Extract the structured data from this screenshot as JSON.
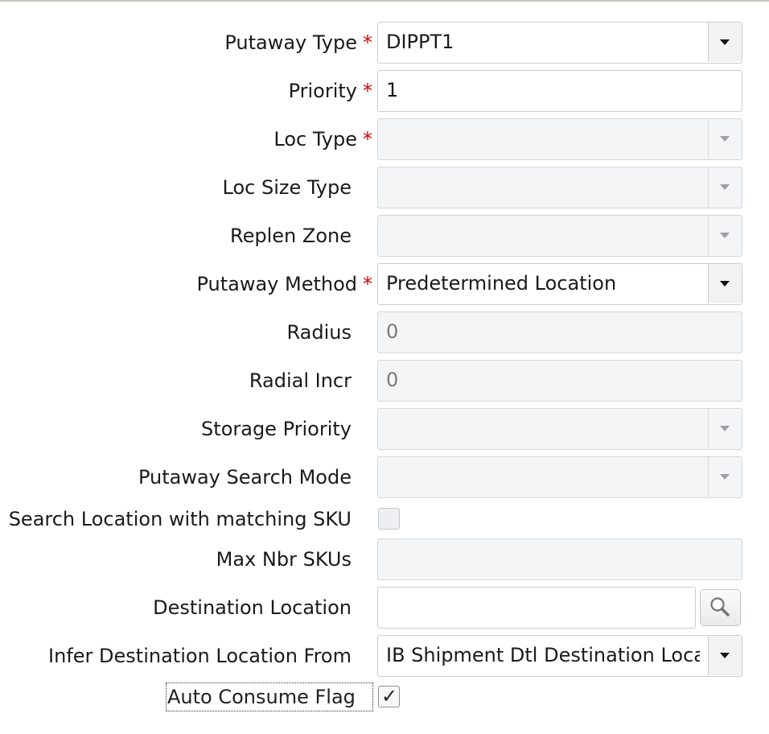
{
  "form": {
    "putaway_type": {
      "label": "Putaway Type",
      "required_mark": "*",
      "value": "DIPPT1"
    },
    "priority": {
      "label": "Priority",
      "required_mark": "*",
      "value": "1"
    },
    "loc_type": {
      "label": "Loc Type",
      "required_mark": "*",
      "value": ""
    },
    "loc_size_type": {
      "label": "Loc Size Type",
      "value": ""
    },
    "replen_zone": {
      "label": "Replen Zone",
      "value": ""
    },
    "putaway_method": {
      "label": "Putaway Method",
      "required_mark": "*",
      "value": "Predetermined Location"
    },
    "radius": {
      "label": "Radius",
      "value": "0"
    },
    "radial_incr": {
      "label": "Radial Incr",
      "value": "0"
    },
    "storage_priority": {
      "label": "Storage Priority",
      "value": ""
    },
    "putaway_search_mode": {
      "label": "Putaway Search Mode",
      "value": ""
    },
    "search_location_matching_sku": {
      "label": "Search Location with matching SKU",
      "checked": false
    },
    "max_nbr_skus": {
      "label": "Max Nbr SKUs",
      "value": ""
    },
    "destination_location": {
      "label": "Destination Location",
      "value": ""
    },
    "infer_destination_location_from": {
      "label": "Infer Destination Location From",
      "value": "IB Shipment Dtl Destination Locat"
    },
    "auto_consume_flag": {
      "label": "Auto Consume Flag",
      "checked": true,
      "check_glyph": "✓"
    }
  },
  "icons": {
    "dropdown": "chevron-down-icon",
    "search": "search-icon",
    "check": "checkmark-icon"
  },
  "colors": {
    "required": "#d40000",
    "disabled_bg": "#f4f5f6",
    "border": "#c9cdd1"
  }
}
